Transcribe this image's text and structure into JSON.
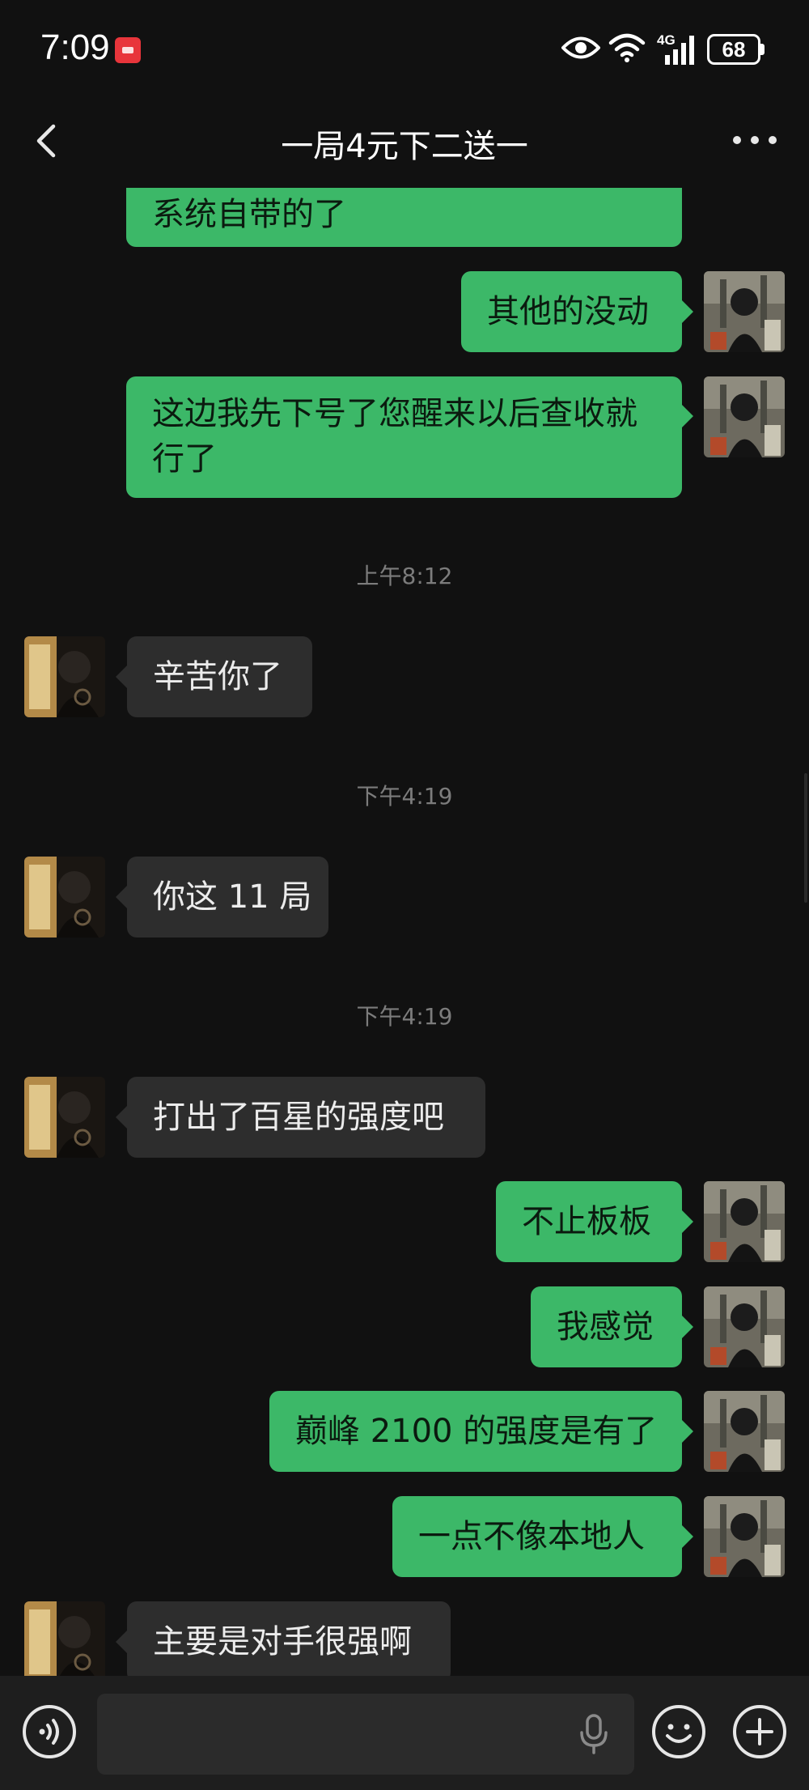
{
  "status_bar": {
    "time": "7:09",
    "network": "4G",
    "battery": "68",
    "icons": [
      "huawei-app-icon",
      "eye-icon",
      "wifi-icon",
      "signal-icon",
      "battery-icon"
    ]
  },
  "header": {
    "title": "一局4元下二送一",
    "back_icon": "chevron-left-icon",
    "more_icon": "more-dots-icon"
  },
  "messages": [
    {
      "side": "out",
      "text": "系统自带的了"
    },
    {
      "side": "out",
      "text": "其他的没动"
    },
    {
      "side": "out",
      "text_line1": "这边我先下号了您醒来以后查收就",
      "text_line2": "行了"
    },
    {
      "type": "time",
      "text": "上午8:12"
    },
    {
      "side": "in",
      "text": "辛苦你了"
    },
    {
      "type": "time",
      "text": "下午4:19"
    },
    {
      "side": "in",
      "text": "你这 11 局"
    },
    {
      "type": "time",
      "text": "下午4:19"
    },
    {
      "side": "in",
      "text": "打出了百星的强度吧"
    },
    {
      "side": "out",
      "text": "不止板板"
    },
    {
      "side": "out",
      "text": "我感觉"
    },
    {
      "side": "out",
      "text": "巅峰 2100 的强度是有了"
    },
    {
      "side": "out",
      "text": "一点不像本地人"
    },
    {
      "side": "in",
      "text": "主要是对手很强啊"
    }
  ],
  "colors": {
    "background": "#111111",
    "outgoing_bubble": "#3cb868",
    "incoming_bubble": "#2d2d2d",
    "input_bar": "#1e1e1e"
  },
  "input_bar": {
    "placeholder": "",
    "icons": [
      "voice-icon",
      "mic-icon",
      "emoji-icon",
      "plus-icon"
    ]
  }
}
